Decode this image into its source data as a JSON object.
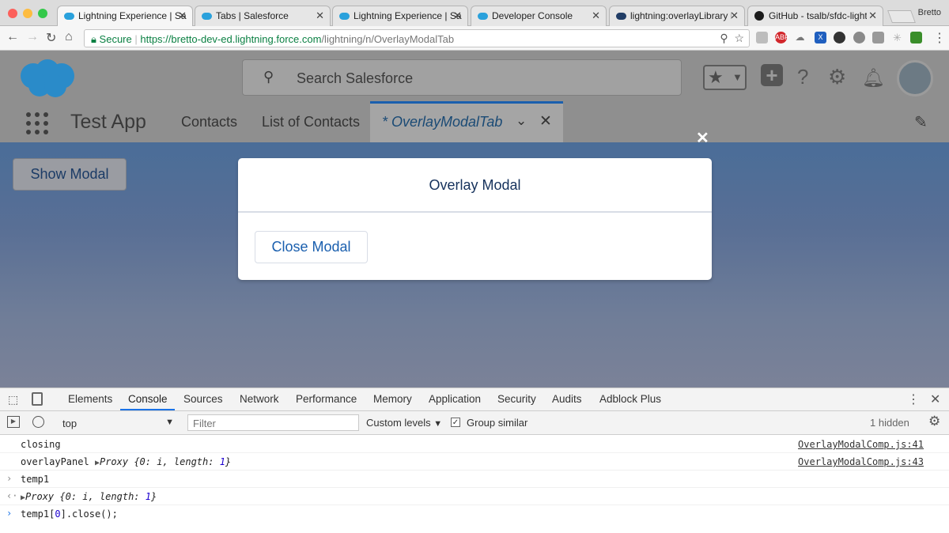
{
  "browser": {
    "tabs": [
      {
        "label": "Lightning Experience | Sa",
        "active": true
      },
      {
        "label": "Tabs | Salesforce",
        "active": false
      },
      {
        "label": "Lightning Experience | Sa",
        "active": false
      },
      {
        "label": "Developer Console",
        "active": false
      },
      {
        "label": "lightning:overlayLibrary M",
        "active": false
      },
      {
        "label": "GitHub - tsalb/sfdc-lightn",
        "active": false
      }
    ],
    "profile_name": "Bretto",
    "secure_label": "Secure",
    "url_scheme_host": "https://bretto-dev-ed.lightning.force.com",
    "url_path": "/lightning/n/OverlayModalTab"
  },
  "salesforce": {
    "search_placeholder": "Search Salesforce",
    "app_name": "Test App",
    "nav_items": [
      "Contacts",
      "List of Contacts"
    ],
    "active_tab_label": "* OverlayModalTab"
  },
  "page": {
    "show_modal_label": "Show Modal",
    "modal_title": "Overlay Modal",
    "close_modal_label": "Close Modal"
  },
  "devtools": {
    "tabs": [
      "Elements",
      "Console",
      "Sources",
      "Network",
      "Performance",
      "Memory",
      "Application",
      "Security",
      "Audits",
      "Adblock Plus"
    ],
    "active_tab": "Console",
    "context": "top",
    "filter_placeholder": "Filter",
    "levels_label": "Custom levels",
    "group_similar_label": "Group similar",
    "group_similar_checked": true,
    "hidden_count": "1 hidden",
    "lines": [
      {
        "text": "closing",
        "source": "OverlayModalComp.js:41"
      },
      {
        "text_prefix": "overlayPanel",
        "source": "OverlayModalComp.js:43"
      },
      {
        "text": "temp1"
      },
      {
        "text": "temp1[0].close();"
      }
    ]
  }
}
